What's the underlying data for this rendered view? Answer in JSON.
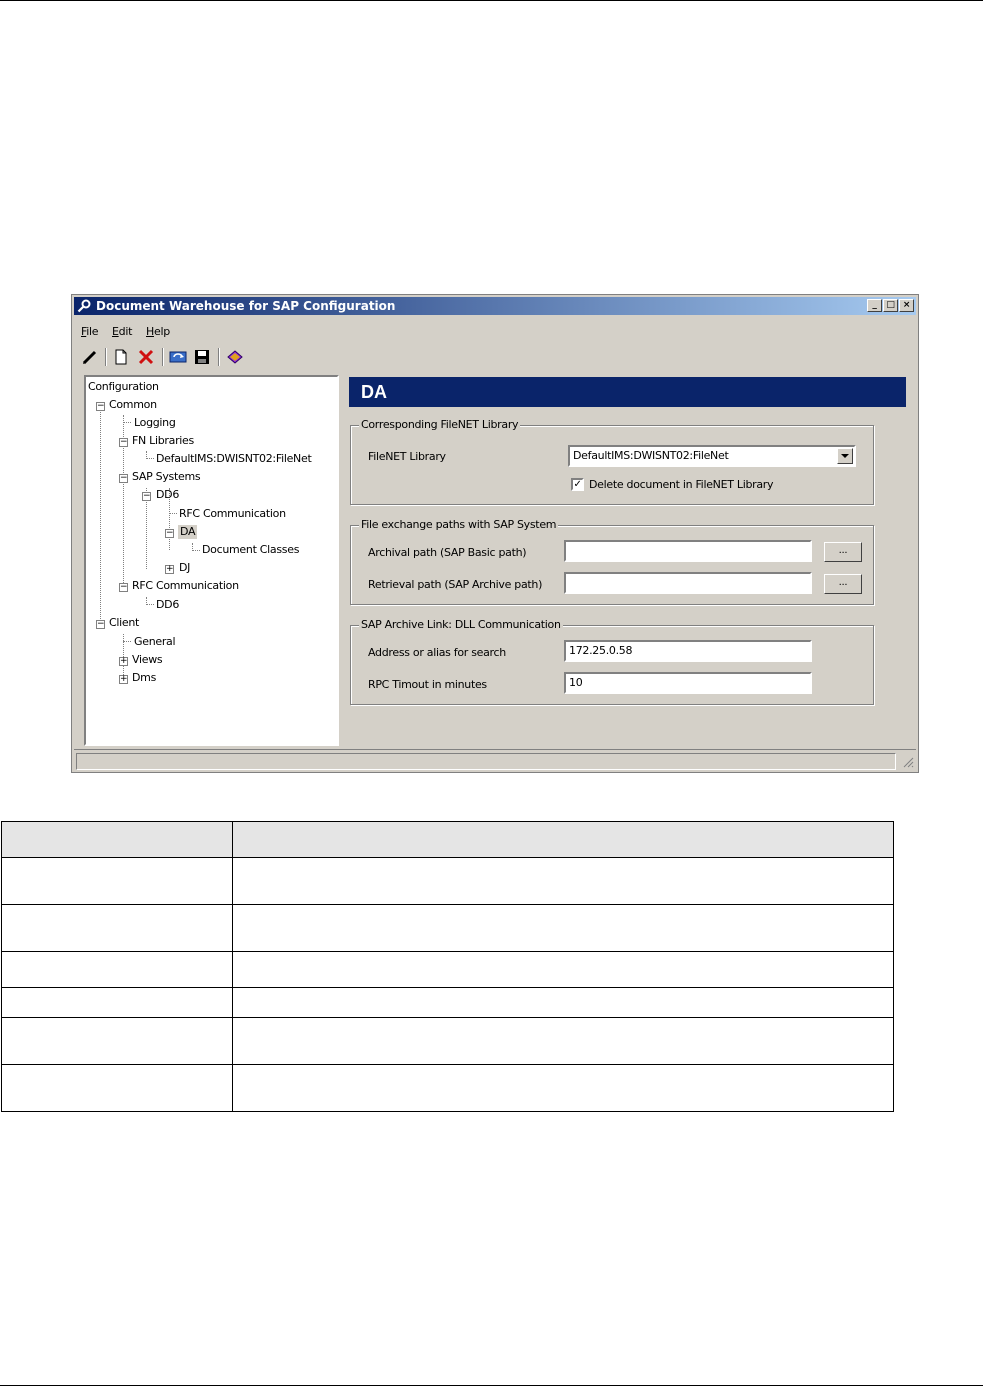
{
  "window": {
    "title": "Document Warehouse for SAP Configuration",
    "minimize": "_",
    "maximize": "□",
    "close": "×"
  },
  "menu": {
    "file": "File",
    "edit": "Edit",
    "help": "Help"
  },
  "toolbar_icons": [
    "pen-icon",
    "new-document-icon",
    "delete-icon",
    "refresh-icon",
    "save-icon",
    "book-icon"
  ],
  "tree": {
    "root": "Configuration",
    "common": "Common",
    "logging": "Logging",
    "fn_libraries": "FN Libraries",
    "fn_default": "DefaultIMS:DWISNT02:FileNet",
    "sap_systems": "SAP Systems",
    "dd6": "DD6",
    "rfc_comm": "RFC Communication",
    "da": "DA",
    "doc_classes": "Document Classes",
    "dj": "DJ",
    "rfc_comm2": "RFC Communication",
    "dd6_2": "DD6",
    "client": "Client",
    "general": "General",
    "views": "Views",
    "dms": "Dms"
  },
  "panel": {
    "header": "DA",
    "group1": {
      "label": "Corresponding FileNET Library",
      "library_label": "FileNET Library",
      "library_value": "DefaultIMS:DWISNT02:FileNet",
      "delete_checked": true,
      "delete_label": "Delete document in FileNET Library"
    },
    "group2": {
      "label": "File exchange paths with SAP System",
      "archival_label": "Archival path (SAP Basic path)",
      "archival_value": "",
      "retrieval_label": "Retrieval path (SAP Archive path)",
      "retrieval_value": "",
      "browse_label": "..."
    },
    "group3": {
      "label": "SAP Archive Link: DLL Communication",
      "address_label": "Address or alias for search",
      "address_value": "172.25.0.58",
      "timeout_label": "RPC Timout in minutes",
      "timeout_value": "10"
    }
  }
}
